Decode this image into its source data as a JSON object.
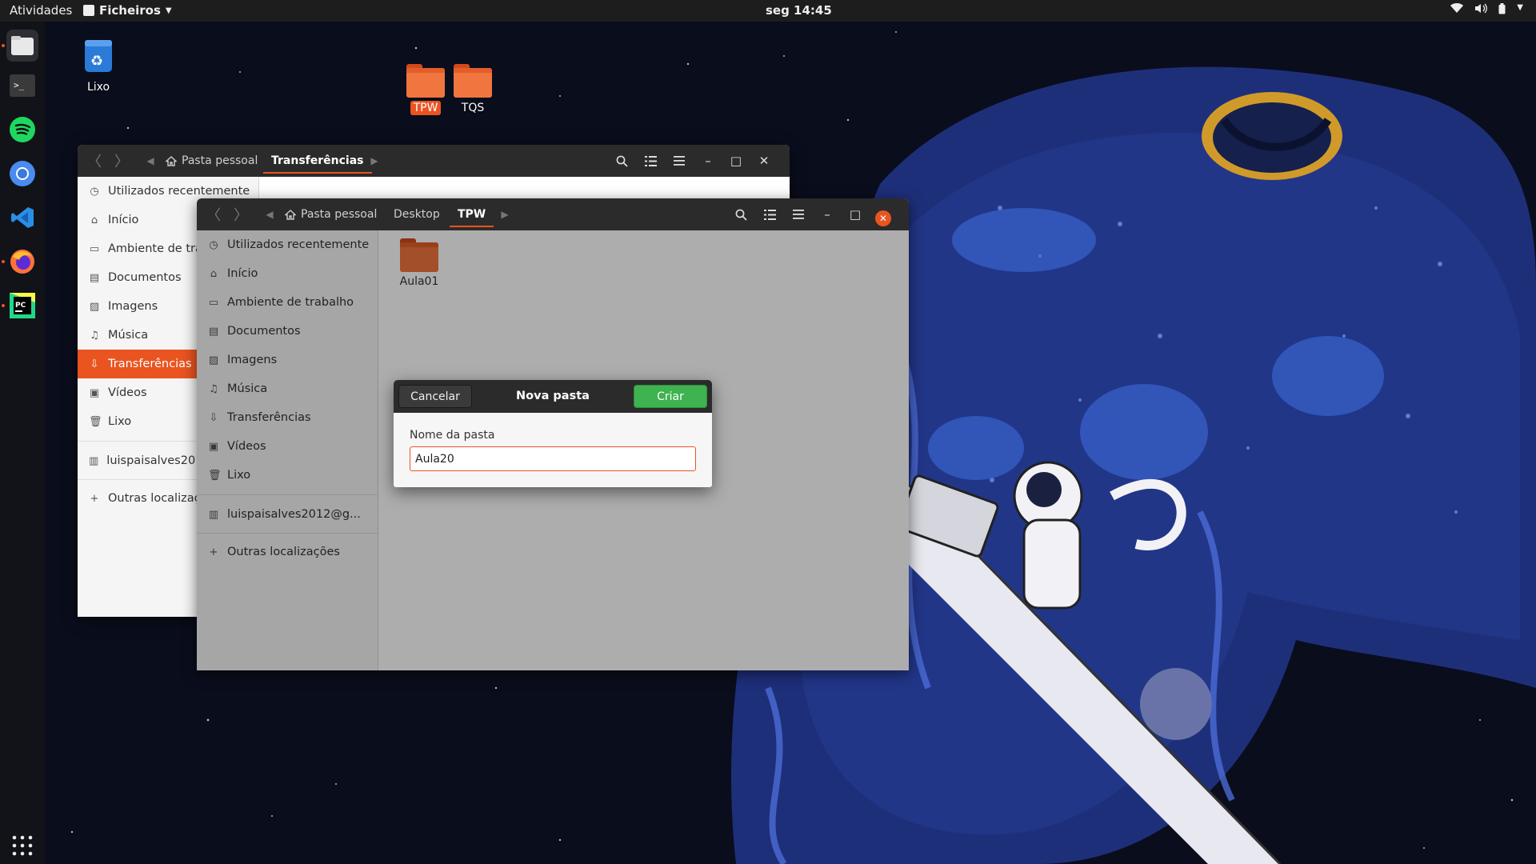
{
  "topbar": {
    "activities": "Atividades",
    "app_menu": "Ficheiros",
    "clock": "seg 14:45",
    "tray_icons": [
      "wifi-icon",
      "volume-icon",
      "battery-icon",
      "chevron-down-icon"
    ]
  },
  "dock": {
    "apps": [
      "files",
      "terminal",
      "spotify",
      "chromium",
      "vscode",
      "firefox",
      "pycharm"
    ],
    "show_apps": "show-applications-icon"
  },
  "desktop": {
    "trash_label": "Lixo",
    "folders": [
      {
        "label": "TPW",
        "selected": true
      },
      {
        "label": "TQS",
        "selected": false
      }
    ]
  },
  "back_window": {
    "breadcrumbs": [
      "Pasta pessoal",
      "Transferências"
    ],
    "sidebar": [
      "Utilizados recentemente",
      "Início",
      "Ambiente de trabalho",
      "Documentos",
      "Imagens",
      "Música",
      "Transferências",
      "Vídeos",
      "Lixo",
      "luispaisalves2012@gmail.com",
      "Outras localizações"
    ],
    "selected_item": "Transferências"
  },
  "front_window": {
    "breadcrumbs": [
      "Pasta pessoal",
      "Desktop",
      "TPW"
    ],
    "sidebar": [
      "Utilizados recentemente",
      "Início",
      "Ambiente de trabalho",
      "Documentos",
      "Imagens",
      "Música",
      "Transferências",
      "Vídeos",
      "Lixo",
      "luispaisalves2012@g...",
      "Outras localizações"
    ],
    "files": [
      {
        "name": "Aula01",
        "type": "folder"
      }
    ]
  },
  "dialog": {
    "cancel_label": "Cancelar",
    "title": "Nova pasta",
    "create_label": "Criar",
    "field_label": "Nome da pasta",
    "field_value": "Aula20"
  },
  "colors": {
    "accent": "#e95420",
    "create_button": "#3eb34f",
    "topbar": "#1d1d1d",
    "headerbar": "#2b2b2b",
    "folder": "#f0753e"
  }
}
